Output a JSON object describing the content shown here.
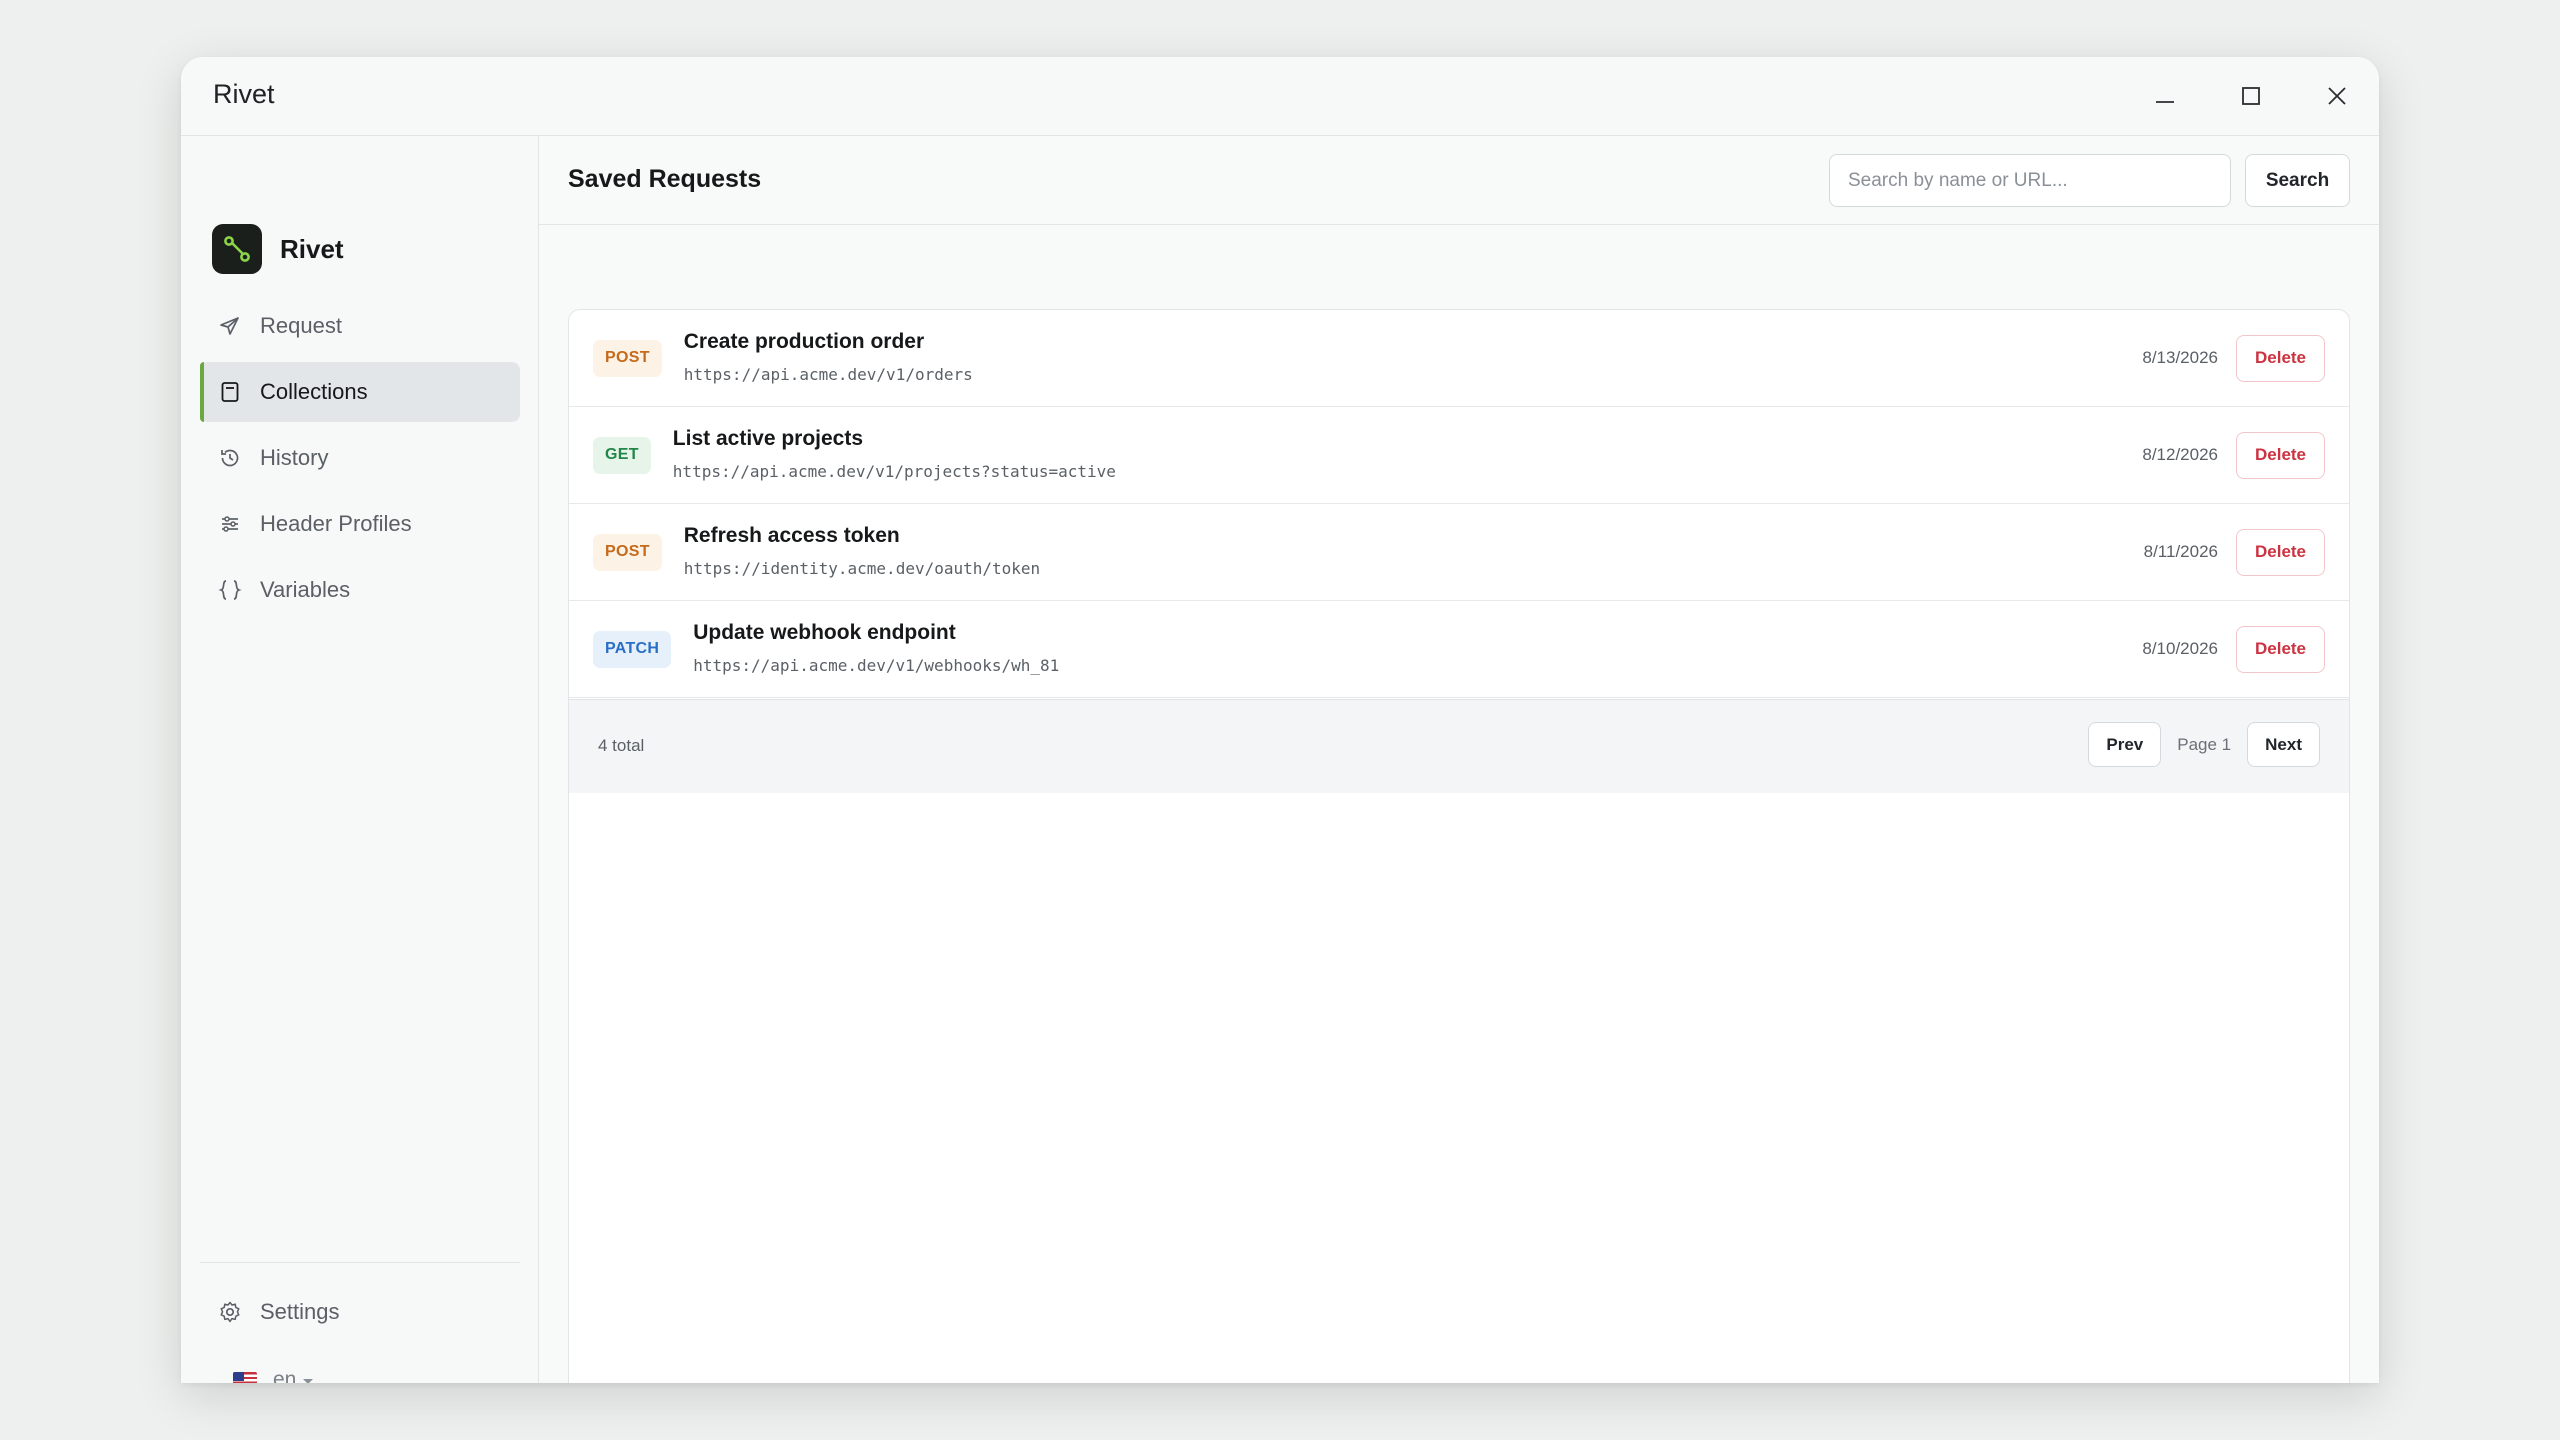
{
  "window": {
    "title": "Rivet"
  },
  "sidebar": {
    "brand": "Rivet",
    "items": [
      {
        "label": "Request",
        "icon": "send-icon"
      },
      {
        "label": "Collections",
        "icon": "bookmark-book-icon",
        "active": true
      },
      {
        "label": "History",
        "icon": "history-icon"
      },
      {
        "label": "Header Profiles",
        "icon": "sliders-icon"
      },
      {
        "label": "Variables",
        "icon": "braces-icon"
      }
    ],
    "settings_label": "Settings",
    "language": "en"
  },
  "main": {
    "title": "Saved Requests",
    "search": {
      "placeholder": "Search by name or URL...",
      "value": "",
      "button_label": "Search"
    },
    "requests": [
      {
        "method": "POST",
        "name": "Create production order",
        "url": "https://api.acme.dev/v1/orders",
        "date": "8/13/2026",
        "action": "Delete"
      },
      {
        "method": "GET",
        "name": "List active projects",
        "url": "https://api.acme.dev/v1/projects?status=active",
        "date": "8/12/2026",
        "action": "Delete"
      },
      {
        "method": "POST",
        "name": "Refresh access token",
        "url": "https://identity.acme.dev/oauth/token",
        "date": "8/11/2026",
        "action": "Delete"
      },
      {
        "method": "PATCH",
        "name": "Update webhook endpoint",
        "url": "https://api.acme.dev/v1/webhooks/wh_81",
        "date": "8/10/2026",
        "action": "Delete"
      }
    ],
    "pager": {
      "total": "4 total",
      "prev": "Prev",
      "page": "Page 1",
      "next": "Next"
    }
  },
  "colors": {
    "accent": "#6ba840",
    "post": "#c56a1b",
    "get": "#22864a",
    "patch": "#2a6fc4",
    "danger": "#cc3340"
  }
}
